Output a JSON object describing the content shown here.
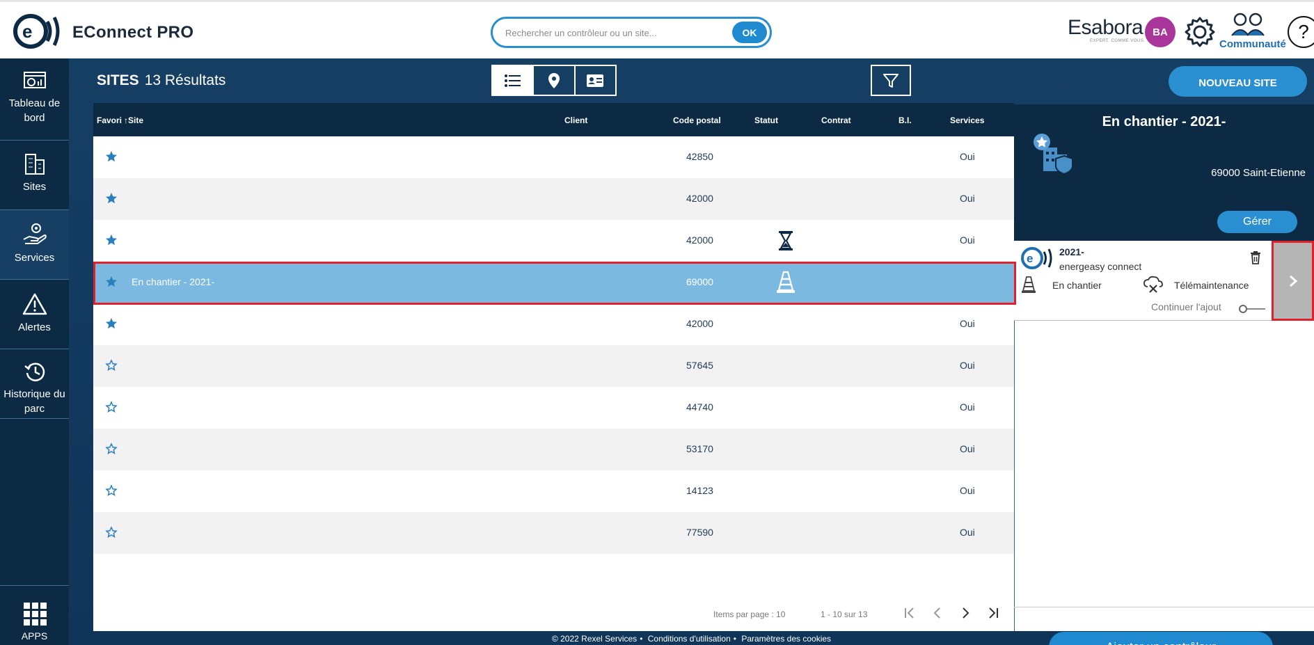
{
  "header": {
    "app_title": "EConnect PRO",
    "search_placeholder": "Rechercher un contrôleur ou un site...",
    "search_button": "OK",
    "brand_name": "Esabora",
    "brand_tagline": "EXPERT. COMME VOUS.",
    "avatar_initials": "BA",
    "community_label": "Communauté",
    "help_label": "?"
  },
  "sidebar": {
    "items": [
      {
        "label": "Tableau de bord",
        "icon": "dashboard-icon"
      },
      {
        "label": "Sites",
        "icon": "buildings-icon"
      },
      {
        "label": "Services",
        "icon": "service-hand-icon"
      },
      {
        "label": "Alertes",
        "icon": "alert-icon"
      },
      {
        "label": "Historique du parc",
        "icon": "history-icon"
      }
    ],
    "apps_label": "APPS"
  },
  "toolbar": {
    "title": "SITES",
    "result_count": "13 Résultats",
    "new_site": "NOUVEAU SITE"
  },
  "table": {
    "columns": [
      "Favori",
      "Site",
      "Client",
      "Code postal",
      "Statut",
      "Contrat",
      "B.I.",
      "Services"
    ],
    "rows": [
      {
        "favori": true,
        "site": "",
        "code_postal": "42850",
        "statut": "",
        "services": "Oui"
      },
      {
        "favori": true,
        "site": "",
        "code_postal": "42000",
        "statut": "",
        "services": "Oui"
      },
      {
        "favori": true,
        "site": "",
        "code_postal": "42000",
        "statut": "hourglass-icon",
        "services": "Oui"
      },
      {
        "favori": true,
        "site": "En chantier - 2021-",
        "code_postal": "69000",
        "statut": "cone-icon",
        "services": "",
        "selected": true
      },
      {
        "favori": true,
        "site": "",
        "code_postal": "42000",
        "statut": "",
        "services": "Oui"
      },
      {
        "favori": false,
        "site": "",
        "code_postal": "57645",
        "statut": "",
        "services": "Oui"
      },
      {
        "favori": false,
        "site": "",
        "code_postal": "44740",
        "statut": "",
        "services": "Oui"
      },
      {
        "favori": false,
        "site": "",
        "code_postal": "53170",
        "statut": "",
        "services": "Oui"
      },
      {
        "favori": false,
        "site": "",
        "code_postal": "14123",
        "statut": "",
        "services": "Oui"
      },
      {
        "favori": false,
        "site": "",
        "code_postal": "77590",
        "statut": "",
        "services": "Oui"
      }
    ],
    "pagination": {
      "items_per_page": "Items par page : 10",
      "range": "1 - 10 sur 13"
    }
  },
  "detail": {
    "title": "En chantier - 2021-",
    "address": "69000 Saint-Etienne",
    "manage_button": "Gérer",
    "controller": {
      "name": "2021-",
      "type": "energeasy connect",
      "status": "En chantier",
      "service": "Télémaintenance",
      "continue_label": "Continuer l'ajout"
    },
    "add_controller_button": "Ajouter un contrôleur"
  },
  "footer": {
    "copyright": "© 2022 Rexel Services",
    "terms": "Conditions d'utilisation",
    "cookies": "Paramètres des cookies"
  },
  "colors": {
    "navy": "#0c2a44",
    "accent": "#1f8ad0",
    "selected_row": "#7cb9e0",
    "highlight": "#e0202a",
    "avatar": "#a9359b"
  }
}
